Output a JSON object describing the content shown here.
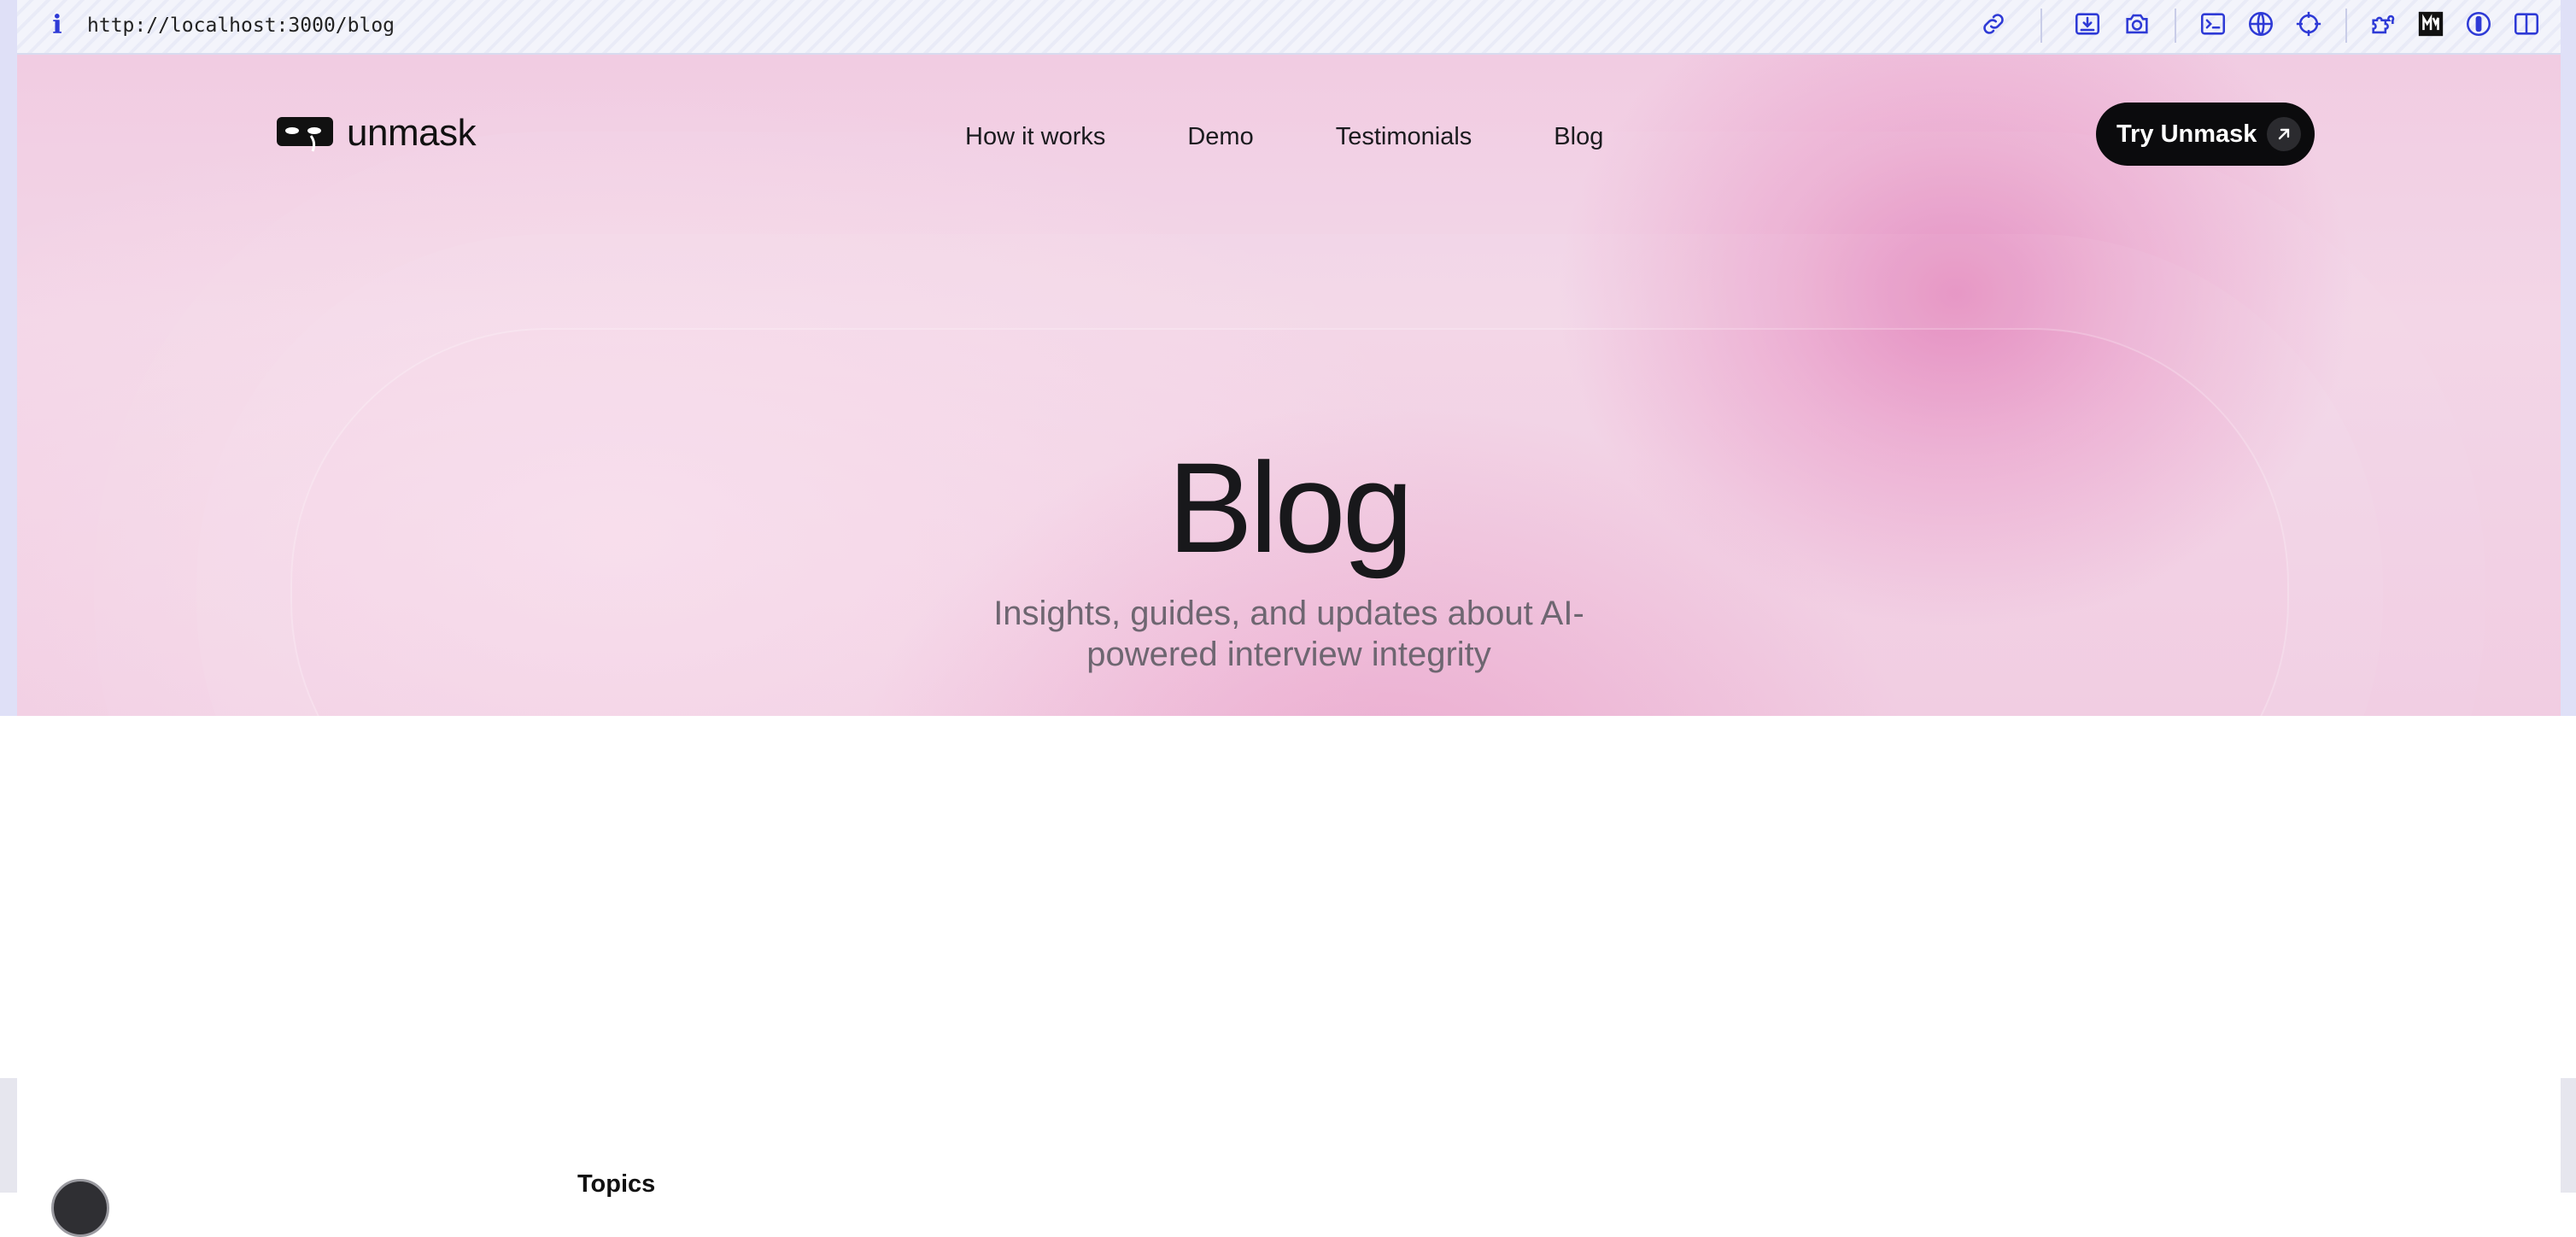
{
  "browser": {
    "url": "http://localhost:3000/blog",
    "info_icon": "info-icon",
    "toolbar_icons": [
      "link-icon",
      "download-icon",
      "camera-icon",
      "terminal-icon",
      "globe-icon",
      "crosshair-icon",
      "puzzle-icon",
      "markdown-icon",
      "password-manager-icon",
      "sidebar-toggle-icon"
    ],
    "accent_color": "#2e3ad6"
  },
  "header": {
    "logo_text": "unmask",
    "nav": [
      {
        "label": "How it works"
      },
      {
        "label": "Demo"
      },
      {
        "label": "Testimonials"
      },
      {
        "label": "Blog"
      }
    ],
    "cta_label": "Try Unmask",
    "cta_icon": "arrow-up-right-icon"
  },
  "hero": {
    "title": "Blog",
    "subtitle": "Insights, guides, and updates about AI-powered interview integrity"
  },
  "sidebar": {
    "topics_label": "Topics"
  },
  "colors": {
    "hero_pink": "#f0cfe3",
    "hero_accent": "#e282ba",
    "cta_bg": "#0b0b0d",
    "text_dark": "#18181b",
    "text_muted": "#6e6671"
  }
}
